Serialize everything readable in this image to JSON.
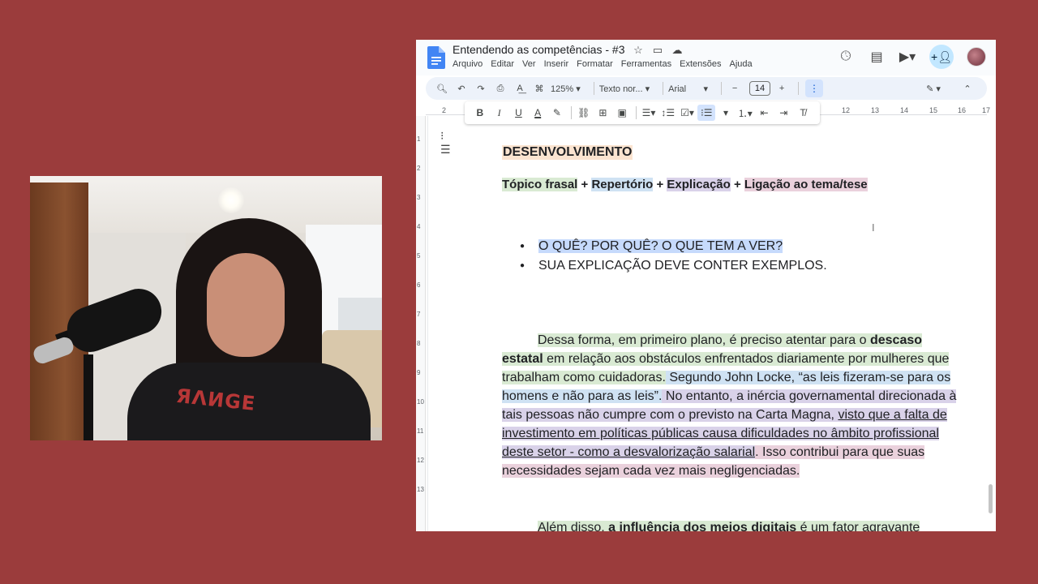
{
  "doc": {
    "title": "Entendendo as competências - #3",
    "menu": [
      "Arquivo",
      "Editar",
      "Ver",
      "Inserir",
      "Formatar",
      "Ferramentas",
      "Extensões",
      "Ajuda"
    ],
    "toolbar": {
      "zoom": "125%",
      "style": "Texto nor...",
      "font": "Arial",
      "font_size": "14"
    },
    "ruler_marks": [
      "2",
      "12",
      "13",
      "14",
      "15",
      "16",
      "17"
    ],
    "vruler_marks": [
      "1",
      "2",
      "3",
      "4",
      "5",
      "6",
      "7",
      "8",
      "9",
      "10",
      "11",
      "12",
      "13"
    ],
    "content": {
      "heading": "DESENVOLVIMENTO",
      "formula": {
        "p1": "Tópico frasal",
        "plus1": " + ",
        "p2": "Repertório",
        "plus2": " + ",
        "p3": "Explicação",
        "plus3": " + ",
        "p4": "Ligação ao tema/tese"
      },
      "bullets": [
        "O QUÊ? POR QUÊ? O QUE TEM A VER?",
        "SUA EXPLICAÇÃO DEVE CONTER EXEMPLOS."
      ],
      "paragraph1": {
        "s1": "Dessa forma, em primeiro plano, é preciso atentar para o ",
        "s1_bold": "descaso estatal",
        "s1_end": " em relação aos obstáculos enfrentados diariamente por mulheres que trabalham como cuidadoras.",
        "s2": " Segundo John Locke, “as leis fizeram-se para os homens e não para as leis”.",
        "s3": " No entanto, a inércia governamental direcionada à tais pessoas não cumpre com o previsto na Carta Magna, ",
        "s3_underline": "visto que a falta de investimento em políticas públicas causa dificuldades no âmbito profissional deste setor - como a desvalorização salarial",
        "s4": ". Isso contribui para que suas necessidades sejam cada vez mais negligenciadas."
      },
      "paragraph2": {
        "start": "Além disso, ",
        "bold": "a influência dos meios digitais",
        "end": " é um fator agravante"
      }
    }
  }
}
